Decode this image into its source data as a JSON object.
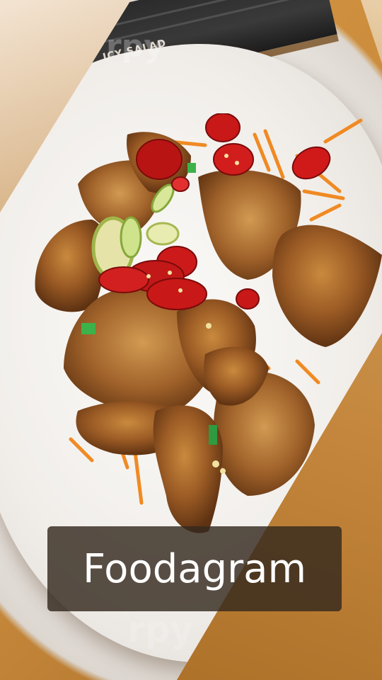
{
  "caption": "Foodagram",
  "menu_board_text": "ICY SALAD",
  "watermarks": {
    "top": "rpy",
    "bottom": "rpy"
  },
  "colors": {
    "frame_light": "#f3dcc0",
    "frame_dark": "#b87a35",
    "plate": "#f4f1ed",
    "food": "#9a5a24",
    "chili": "#c81818",
    "carrot": "#f08a23",
    "caption_bg": "#342a1e"
  }
}
